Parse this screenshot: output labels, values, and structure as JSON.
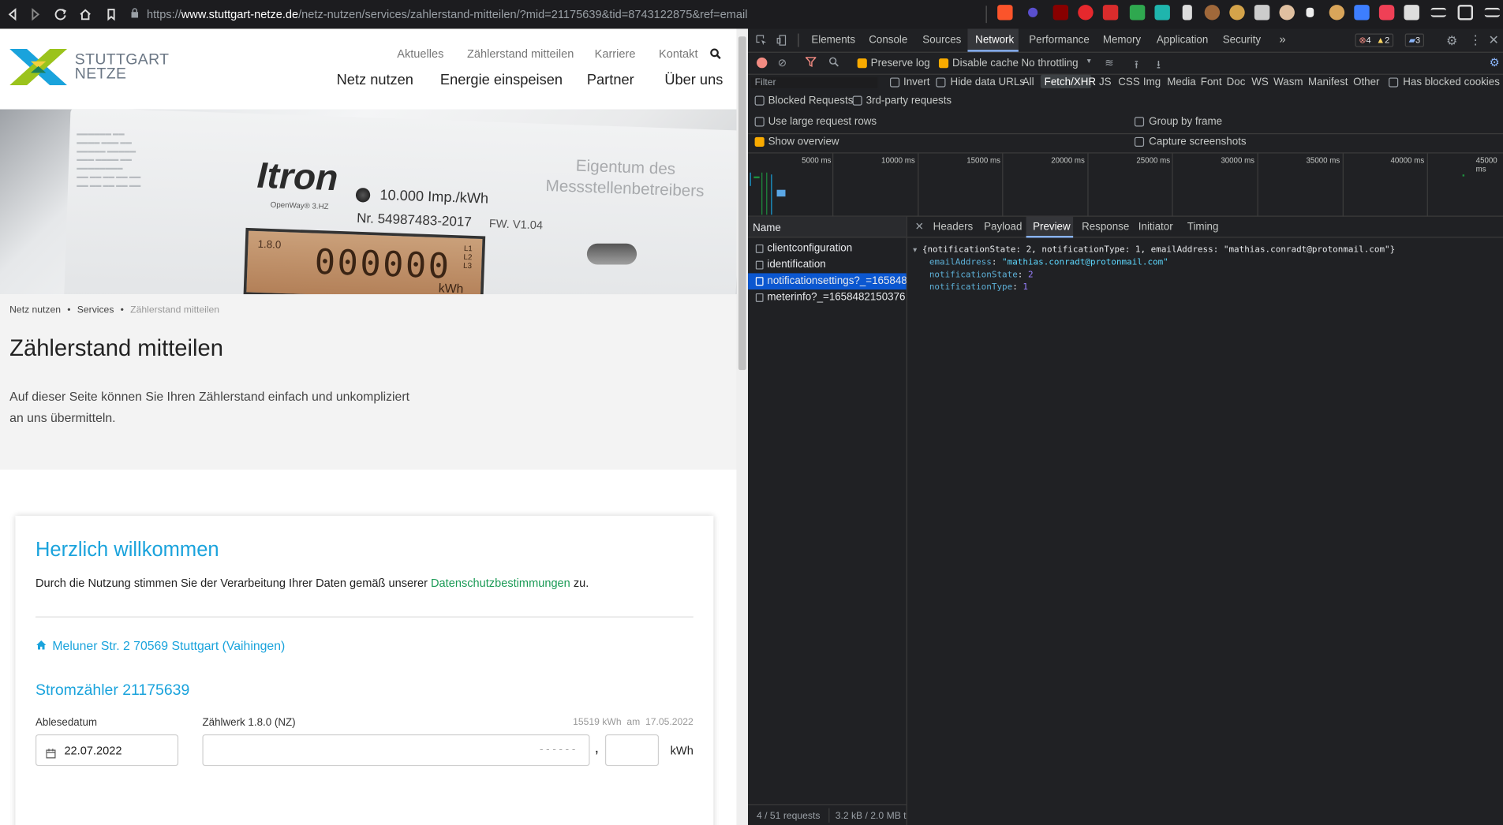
{
  "browser": {
    "url_prefix": "https://",
    "url_domain": "www.stuttgart-netze.de",
    "url_path": "/netz-nutzen/services/zahlerstand-mitteilen/?mid=21175639&tid=8743122875&ref=email"
  },
  "site": {
    "logo_line1": "STUTTGART",
    "logo_line2": "NETZE",
    "top_links": [
      "Aktuelles",
      "Zählerstand mitteilen",
      "Karriere",
      "Kontakt"
    ],
    "main_nav": [
      "Netz nutzen",
      "Energie einspeisen",
      "Partner",
      "Über uns"
    ],
    "hero": {
      "brand": "Itron",
      "model": "OpenWay® 3.HZ",
      "imp": "10.000 Imp./kWh",
      "serial": "Nr. 54987483-2017",
      "fw": "FW. V1.04",
      "owner": "Eigentum des Messstellenbetreibers",
      "lcd": "000000",
      "lcd_unit": "kWh",
      "phases": "L1 L2 L3",
      "lcd_prefix": "1.8.0"
    },
    "breadcrumb": [
      "Netz nutzen",
      "Services",
      "Zählerstand mitteilen"
    ],
    "title": "Zählerstand mitteilen",
    "intro_line1": "Auf dieser Seite können Sie Ihren Zählerstand einfach und unkompliziert",
    "intro_line2": "an uns übermitteln.",
    "card": {
      "heading": "Herzlich willkommen",
      "consent_prefix": "Durch die Nutzung stimmen Sie der Verarbeitung Ihrer Daten gemäß unserer",
      "consent_link": "Datenschutzbestimmungen",
      "consent_suffix": "zu.",
      "address": "Meluner Str. 2 70569 Stuttgart (Vaihingen)",
      "meter_title": "Stromzähler 21175639",
      "date_label": "Ablesedatum",
      "date_value": "22.07.2022",
      "register_label": "Zählwerk 1.8.0 (NZ)",
      "last_reading": "15519 kWh  am  17.05.2022",
      "reading_placeholder": "- - - - - -",
      "comma": ",",
      "unit": "kWh"
    }
  },
  "devtools": {
    "tabs": [
      "Elements",
      "Console",
      "Sources",
      "Network",
      "Performance",
      "Memory",
      "Application",
      "Security"
    ],
    "active_tab": "Network",
    "badges": {
      "errors": "4",
      "warnings": "2",
      "messages": "3"
    },
    "toolbar": {
      "preserve_log": "Preserve log",
      "disable_cache": "Disable cache",
      "throttling": "No throttling"
    },
    "filter_placeholder": "Filter",
    "filter_opts": {
      "invert": "Invert",
      "hide_data": "Hide data URLs"
    },
    "types": [
      "All",
      "Fetch/XHR",
      "JS",
      "CSS",
      "Img",
      "Media",
      "Font",
      "Doc",
      "WS",
      "Wasm",
      "Manifest",
      "Other"
    ],
    "active_type": "Fetch/XHR",
    "has_blocked_cookies": "Has blocked cookies",
    "blocked_requests": "Blocked Requests",
    "third_party": "3rd-party requests",
    "large_rows": "Use large request rows",
    "group_by_frame": "Group by frame",
    "show_overview": "Show overview",
    "capture_screenshots": "Capture screenshots",
    "timeline": [
      "5000 ms",
      "10000 ms",
      "15000 ms",
      "20000 ms",
      "25000 ms",
      "30000 ms",
      "35000 ms",
      "40000 ms",
      "45000 ms"
    ],
    "name_header": "Name",
    "requests": [
      "clientconfiguration",
      "identification",
      "notificationsettings?_=165848...",
      "meterinfo?_=1658482150376"
    ],
    "selected_request": 2,
    "detail_tabs": [
      "Headers",
      "Payload",
      "Preview",
      "Response",
      "Initiator",
      "Timing"
    ],
    "active_detail": "Preview",
    "preview": {
      "summary": "{notificationState: 2, notificationType: 1, emailAddress: \"mathias.conradt@protonmail.com\"}",
      "fields": [
        {
          "key": "emailAddress",
          "value": "\"mathias.conradt@protonmail.com\"",
          "kind": "string"
        },
        {
          "key": "notificationState",
          "value": "2",
          "kind": "number"
        },
        {
          "key": "notificationType",
          "value": "1",
          "kind": "number"
        }
      ]
    },
    "status": {
      "requests": "4 / 51 requests",
      "transfer": "3.2 kB / 2.0 MB t"
    }
  }
}
